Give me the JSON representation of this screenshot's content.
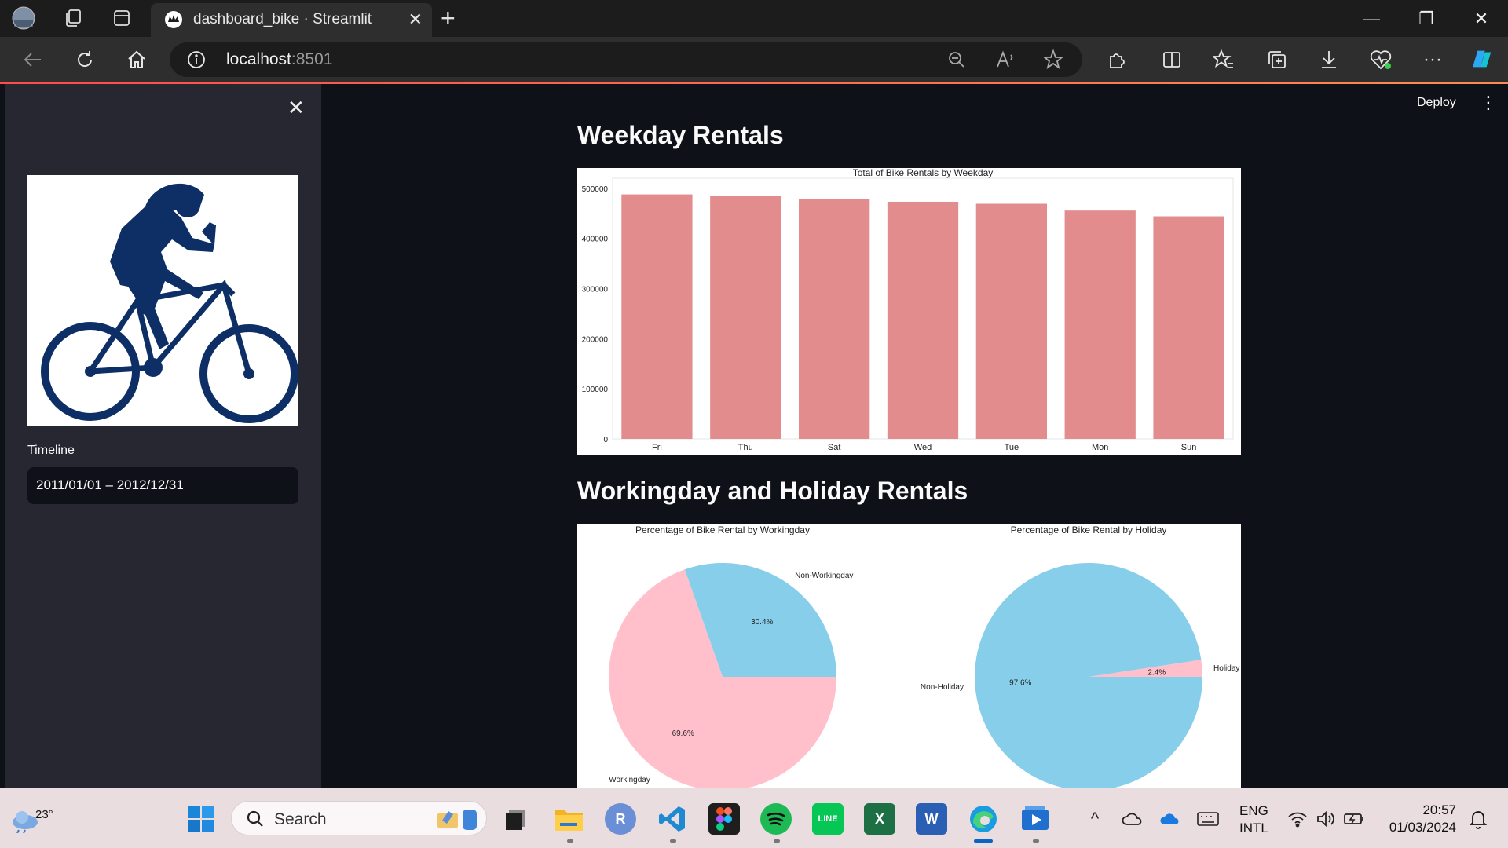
{
  "browser": {
    "tab_title": "dashboard_bike · Streamlit",
    "tab_close": "✕",
    "new_tab": "+",
    "url_host": "localhost",
    "url_port": ":8501",
    "window_controls": {
      "minimize": "—",
      "restore": "❐",
      "close": "✕"
    }
  },
  "sidebar": {
    "close": "✕",
    "timeline_label": "Timeline",
    "date_range": "2011/01/01 – 2012/12/31"
  },
  "header": {
    "deploy": "Deploy",
    "menu": "⋮"
  },
  "sections": {
    "weekday_title": "Weekday Rentals",
    "workingday_title": "Workingday and Holiday Rentals"
  },
  "colors": {
    "bar": "#e38c8e",
    "pie_blue": "#87ceeb",
    "pie_pink": "#ffc0cb",
    "streamlit_red": "#ff4b4b"
  },
  "chart_data": [
    {
      "type": "bar",
      "title": "Total of Bike Rentals by Weekday",
      "categories": [
        "Fri",
        "Thu",
        "Sat",
        "Wed",
        "Tue",
        "Mon",
        "Sun"
      ],
      "values": [
        487790,
        485395,
        477807,
        473048,
        469109,
        455503,
        444027
      ],
      "ylim": [
        0,
        520000
      ],
      "yticks": [
        "0",
        "100000",
        "200000",
        "300000",
        "400000",
        "500000"
      ],
      "xlabel": "",
      "ylabel": ""
    },
    {
      "type": "pie",
      "title": "Percentage of Bike Rental by Workingday",
      "labels": [
        "Non-Workingday",
        "Workingday"
      ],
      "values": [
        30.4,
        69.6
      ],
      "value_labels": [
        "30.4%",
        "69.6%"
      ]
    },
    {
      "type": "pie",
      "title": "Percentage of Bike Rental by Holiday",
      "labels": [
        "Holiday",
        "Non-Holiday"
      ],
      "values": [
        2.4,
        97.6
      ],
      "value_labels": [
        "2.4%",
        "97.6%"
      ]
    }
  ],
  "taskbar": {
    "temperature": "23°",
    "search_placeholder": "Search",
    "lang_line1": "ENG",
    "lang_line2": "INTL",
    "time": "20:57",
    "date": "01/03/2024"
  }
}
